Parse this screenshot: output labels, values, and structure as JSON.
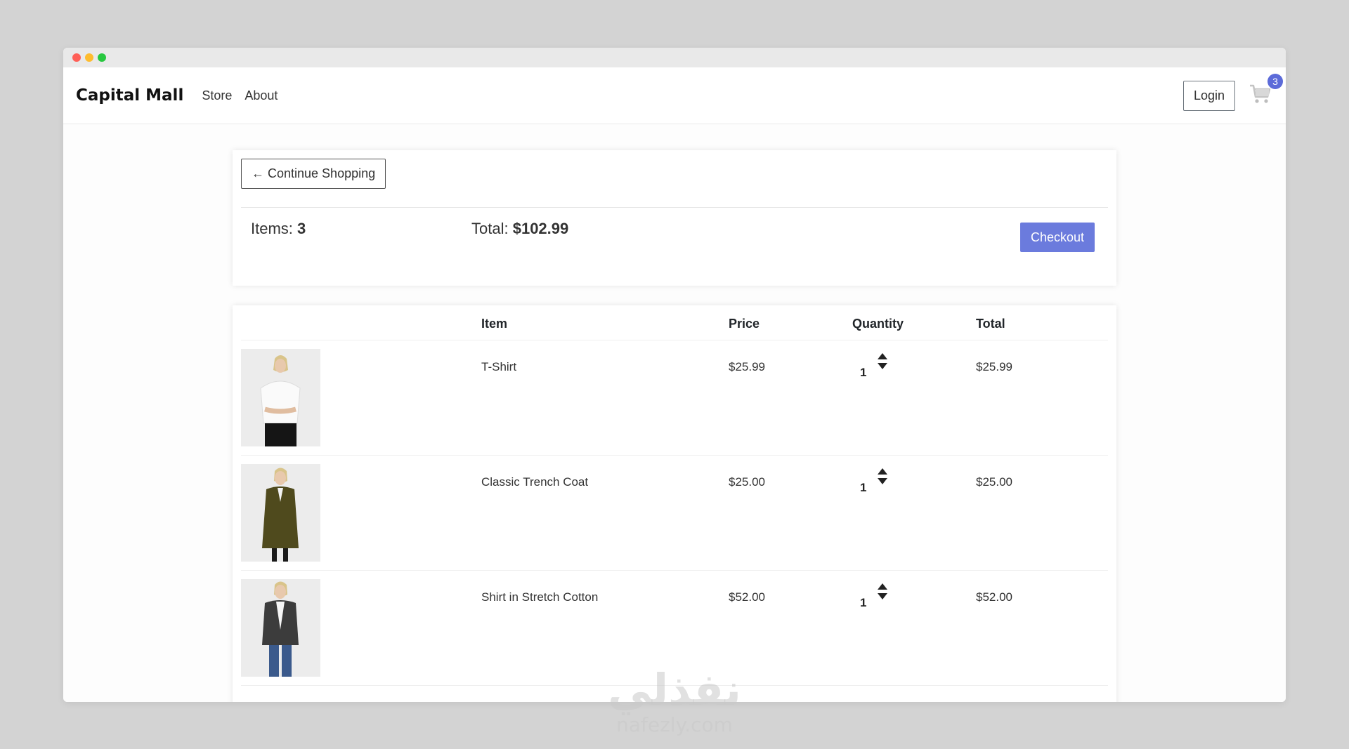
{
  "navbar": {
    "brand": "Capital Mall",
    "links": [
      "Store",
      "About"
    ],
    "login_label": "Login",
    "cart_count": "3"
  },
  "summary": {
    "continue_label": "← Continue Shopping",
    "items_label": "Items:",
    "items_value": "3",
    "total_label": "Total:",
    "total_value": "$102.99",
    "checkout_label": "Checkout"
  },
  "table": {
    "headers": {
      "item": "Item",
      "price": "Price",
      "quantity": "Quantity",
      "total": "Total"
    },
    "rows": [
      {
        "name": "T-Shirt",
        "price": "$25.99",
        "quantity": "1",
        "total": "$25.99",
        "image": "woman-white-tshirt"
      },
      {
        "name": "Classic Trench Coat",
        "price": "$25.00",
        "quantity": "1",
        "total": "$25.00",
        "image": "woman-olive-trench-coat"
      },
      {
        "name": "Shirt in Stretch Cotton",
        "price": "$52.00",
        "quantity": "1",
        "total": "$52.00",
        "image": "woman-dark-blazer-jeans"
      }
    ]
  },
  "watermark": {
    "arabic": "نفذلي",
    "latin": "nafezly.com"
  },
  "colors": {
    "accent": "#6b7bdd",
    "badge": "#5c6bd9",
    "background": "#d3d3d3"
  }
}
